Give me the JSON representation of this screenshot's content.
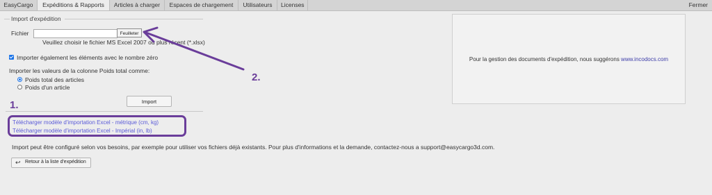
{
  "tabs": [
    {
      "label": "EasyCargo",
      "active": false
    },
    {
      "label": "Expéditions & Rapports",
      "active": true
    },
    {
      "label": "Articles à charger",
      "active": false
    },
    {
      "label": "Espaces de chargement",
      "active": false
    },
    {
      "label": "Utilisateurs",
      "active": false
    },
    {
      "label": "Licenses",
      "active": false
    }
  ],
  "close_label": "Fermer",
  "import_section": {
    "legend": "Import d'expédition",
    "file_label": "Fichier",
    "file_value": "",
    "browse_label": "Feuilleter",
    "file_hint": "Veuillez choisir le fichier MS Excel 2007 ou plus récent (*.xlsx)",
    "zero_checkbox": {
      "label": "Importer également les éléments avec le nombre zéro",
      "checked": true
    },
    "weight_question": "Importer les valeurs de la colonne Poids total comme:",
    "weight_options": [
      {
        "label": "Poids total des articles",
        "selected": true
      },
      {
        "label": "Poids d'un article",
        "selected": false
      }
    ],
    "import_button": "Import"
  },
  "templates": {
    "metric_link": "Télécharger modèle d'importation Excel - métrique (cm, kg)",
    "imperial_link": "Télécharger modèle d'importation Excel - Impérial (in, lb)"
  },
  "info_text": "Import peut être configuré selon vos besoins, par exemple pour utiliser vos fichiers déjà existants. Pour plus d'informations et la demande, contactez-nous a support@easycargo3d.com.",
  "back_button": "Retour à la liste d'expédition",
  "side_panel": {
    "text": "Pour la gestion des documents d'expédition, nous suggérons",
    "link": "www.incodocs.com"
  },
  "annotations": {
    "one": "1.",
    "two": "2."
  },
  "colors": {
    "annotation": "#6a3d9a",
    "link": "#5a5ad8",
    "accent": "#1a73e8"
  }
}
